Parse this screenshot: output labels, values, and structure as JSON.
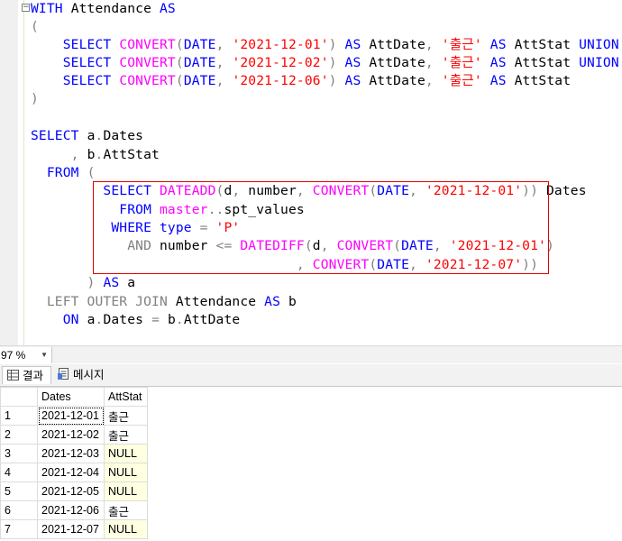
{
  "editor": {
    "collapse_glyph": "−",
    "lines": [
      [
        {
          "t": "WITH ",
          "c": "kw"
        },
        {
          "t": "Attendance ",
          "c": "pl"
        },
        {
          "t": "AS",
          "c": "kw"
        }
      ],
      [
        {
          "t": "(",
          "c": "op"
        }
      ],
      [
        {
          "t": "    SELECT ",
          "c": "kw"
        },
        {
          "t": "CONVERT",
          "c": "fn"
        },
        {
          "t": "(",
          "c": "op"
        },
        {
          "t": "DATE",
          "c": "kw"
        },
        {
          "t": ", ",
          "c": "op"
        },
        {
          "t": "'2021-12-01'",
          "c": "str"
        },
        {
          "t": ") ",
          "c": "op"
        },
        {
          "t": "AS ",
          "c": "kw"
        },
        {
          "t": "AttDate",
          "c": "pl"
        },
        {
          "t": ", ",
          "c": "op"
        },
        {
          "t": "'출근' ",
          "c": "str"
        },
        {
          "t": "AS ",
          "c": "kw"
        },
        {
          "t": "AttStat ",
          "c": "pl"
        },
        {
          "t": "UNION ALL",
          "c": "kw"
        }
      ],
      [
        {
          "t": "    SELECT ",
          "c": "kw"
        },
        {
          "t": "CONVERT",
          "c": "fn"
        },
        {
          "t": "(",
          "c": "op"
        },
        {
          "t": "DATE",
          "c": "kw"
        },
        {
          "t": ", ",
          "c": "op"
        },
        {
          "t": "'2021-12-02'",
          "c": "str"
        },
        {
          "t": ") ",
          "c": "op"
        },
        {
          "t": "AS ",
          "c": "kw"
        },
        {
          "t": "AttDate",
          "c": "pl"
        },
        {
          "t": ", ",
          "c": "op"
        },
        {
          "t": "'출근' ",
          "c": "str"
        },
        {
          "t": "AS ",
          "c": "kw"
        },
        {
          "t": "AttStat ",
          "c": "pl"
        },
        {
          "t": "UNION ALL",
          "c": "kw"
        }
      ],
      [
        {
          "t": "    SELECT ",
          "c": "kw"
        },
        {
          "t": "CONVERT",
          "c": "fn"
        },
        {
          "t": "(",
          "c": "op"
        },
        {
          "t": "DATE",
          "c": "kw"
        },
        {
          "t": ", ",
          "c": "op"
        },
        {
          "t": "'2021-12-06'",
          "c": "str"
        },
        {
          "t": ") ",
          "c": "op"
        },
        {
          "t": "AS ",
          "c": "kw"
        },
        {
          "t": "AttDate",
          "c": "pl"
        },
        {
          "t": ", ",
          "c": "op"
        },
        {
          "t": "'출근' ",
          "c": "str"
        },
        {
          "t": "AS ",
          "c": "kw"
        },
        {
          "t": "AttStat",
          "c": "pl"
        }
      ],
      [
        {
          "t": ")",
          "c": "op"
        }
      ],
      [],
      [
        {
          "t": "SELECT ",
          "c": "kw"
        },
        {
          "t": "a",
          "c": "pl"
        },
        {
          "t": ".",
          "c": "op"
        },
        {
          "t": "Dates",
          "c": "pl"
        }
      ],
      [
        {
          "t": "     , ",
          "c": "op"
        },
        {
          "t": "b",
          "c": "pl"
        },
        {
          "t": ".",
          "c": "op"
        },
        {
          "t": "AttStat",
          "c": "pl"
        }
      ],
      [
        {
          "t": "  FROM ",
          "c": "kw"
        },
        {
          "t": "(",
          "c": "op"
        }
      ],
      [
        {
          "t": "         SELECT ",
          "c": "kw"
        },
        {
          "t": "DATEADD",
          "c": "fn"
        },
        {
          "t": "(",
          "c": "op"
        },
        {
          "t": "d",
          "c": "pl"
        },
        {
          "t": ", ",
          "c": "op"
        },
        {
          "t": "number",
          "c": "pl"
        },
        {
          "t": ", ",
          "c": "op"
        },
        {
          "t": "CONVERT",
          "c": "fn"
        },
        {
          "t": "(",
          "c": "op"
        },
        {
          "t": "DATE",
          "c": "kw"
        },
        {
          "t": ", ",
          "c": "op"
        },
        {
          "t": "'2021-12-01'",
          "c": "str"
        },
        {
          "t": ")) ",
          "c": "op"
        },
        {
          "t": "Dates",
          "c": "pl"
        }
      ],
      [
        {
          "t": "           FROM ",
          "c": "kw"
        },
        {
          "t": "master",
          "c": "fn"
        },
        {
          "t": "..",
          "c": "op"
        },
        {
          "t": "spt_values",
          "c": "pl"
        }
      ],
      [
        {
          "t": "          WHERE ",
          "c": "kw"
        },
        {
          "t": "type ",
          "c": "kw"
        },
        {
          "t": "= ",
          "c": "op"
        },
        {
          "t": "'P'",
          "c": "str"
        }
      ],
      [
        {
          "t": "            AND ",
          "c": "op"
        },
        {
          "t": "number ",
          "c": "pl"
        },
        {
          "t": "<= ",
          "c": "op"
        },
        {
          "t": "DATEDIFF",
          "c": "fn"
        },
        {
          "t": "(",
          "c": "op"
        },
        {
          "t": "d",
          "c": "pl"
        },
        {
          "t": ", ",
          "c": "op"
        },
        {
          "t": "CONVERT",
          "c": "fn"
        },
        {
          "t": "(",
          "c": "op"
        },
        {
          "t": "DATE",
          "c": "kw"
        },
        {
          "t": ", ",
          "c": "op"
        },
        {
          "t": "'2021-12-01'",
          "c": "str"
        },
        {
          "t": ")",
          "c": "op"
        }
      ],
      [
        {
          "t": "                                 , ",
          "c": "op"
        },
        {
          "t": "CONVERT",
          "c": "fn"
        },
        {
          "t": "(",
          "c": "op"
        },
        {
          "t": "DATE",
          "c": "kw"
        },
        {
          "t": ", ",
          "c": "op"
        },
        {
          "t": "'2021-12-07'",
          "c": "str"
        },
        {
          "t": "))",
          "c": "op"
        }
      ],
      [
        {
          "t": "       ) ",
          "c": "op"
        },
        {
          "t": "AS ",
          "c": "kw"
        },
        {
          "t": "a",
          "c": "pl"
        }
      ],
      [
        {
          "t": "  LEFT OUTER JOIN ",
          "c": "op"
        },
        {
          "t": "Attendance ",
          "c": "pl"
        },
        {
          "t": "AS ",
          "c": "kw"
        },
        {
          "t": "b",
          "c": "pl"
        }
      ],
      [
        {
          "t": "    ON ",
          "c": "kw"
        },
        {
          "t": "a",
          "c": "pl"
        },
        {
          "t": ".",
          "c": "op"
        },
        {
          "t": "Dates ",
          "c": "pl"
        },
        {
          "t": "= ",
          "c": "op"
        },
        {
          "t": "b",
          "c": "pl"
        },
        {
          "t": ".",
          "c": "op"
        },
        {
          "t": "AttDate",
          "c": "pl"
        }
      ]
    ]
  },
  "statusbar": {
    "zoom": "97 %"
  },
  "tabs": {
    "results_label": "결과",
    "messages_label": "메시지"
  },
  "grid": {
    "columns": [
      "Dates",
      "AttStat"
    ],
    "rows": [
      {
        "num": "1",
        "dates": "2021-12-01",
        "stat": "출근",
        "is_null": false
      },
      {
        "num": "2",
        "dates": "2021-12-02",
        "stat": "출근",
        "is_null": false
      },
      {
        "num": "3",
        "dates": "2021-12-03",
        "stat": "NULL",
        "is_null": true
      },
      {
        "num": "4",
        "dates": "2021-12-04",
        "stat": "NULL",
        "is_null": true
      },
      {
        "num": "5",
        "dates": "2021-12-05",
        "stat": "NULL",
        "is_null": true
      },
      {
        "num": "6",
        "dates": "2021-12-06",
        "stat": "출근",
        "is_null": false
      },
      {
        "num": "7",
        "dates": "2021-12-07",
        "stat": "NULL",
        "is_null": true
      }
    ]
  },
  "colors": {
    "keyword": "#0000ff",
    "function": "#ff00ff",
    "string": "#ff0000",
    "operator": "#808080",
    "highlight_border": "#e00000",
    "null_cell": "#ffffe1"
  }
}
